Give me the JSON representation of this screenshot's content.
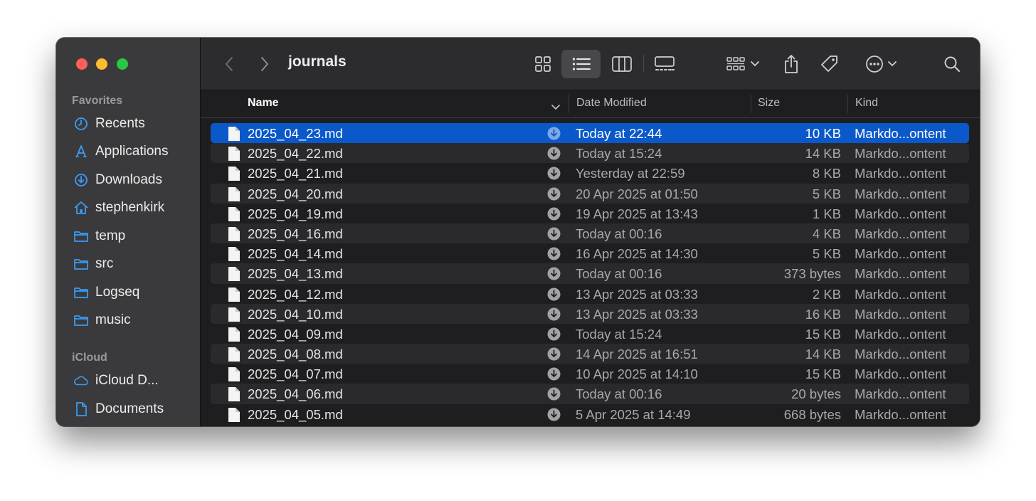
{
  "window": {
    "title": "journals"
  },
  "sidebar": {
    "favorites_label": "Favorites",
    "favorites": [
      {
        "label": "Recents",
        "icon": "clock-icon"
      },
      {
        "label": "Applications",
        "icon": "applications-icon"
      },
      {
        "label": "Downloads",
        "icon": "download-circle-icon"
      },
      {
        "label": "stephenkirk",
        "icon": "home-icon"
      },
      {
        "label": "temp",
        "icon": "folder-icon"
      },
      {
        "label": "src",
        "icon": "folder-icon"
      },
      {
        "label": "Logseq",
        "icon": "folder-icon"
      },
      {
        "label": "music",
        "icon": "folder-icon"
      }
    ],
    "icloud_label": "iCloud",
    "icloud": [
      {
        "label": "iCloud D...",
        "icon": "cloud-icon"
      },
      {
        "label": "Documents",
        "icon": "document-icon"
      }
    ]
  },
  "columns": {
    "name": "Name",
    "date": "Date Modified",
    "size": "Size",
    "kind": "Kind"
  },
  "files": [
    {
      "name": "2025_04_23.md",
      "date": "Today at 22:44",
      "size": "10 KB",
      "kind": "Markdo...ontent"
    },
    {
      "name": "2025_04_22.md",
      "date": "Today at 15:24",
      "size": "14 KB",
      "kind": "Markdo...ontent"
    },
    {
      "name": "2025_04_21.md",
      "date": "Yesterday at 22:59",
      "size": "8 KB",
      "kind": "Markdo...ontent"
    },
    {
      "name": "2025_04_20.md",
      "date": "20 Apr 2025 at 01:50",
      "size": "5 KB",
      "kind": "Markdo...ontent"
    },
    {
      "name": "2025_04_19.md",
      "date": "19 Apr 2025 at 13:43",
      "size": "1 KB",
      "kind": "Markdo...ontent"
    },
    {
      "name": "2025_04_16.md",
      "date": "Today at 00:16",
      "size": "4 KB",
      "kind": "Markdo...ontent"
    },
    {
      "name": "2025_04_14.md",
      "date": "16 Apr 2025 at 14:30",
      "size": "5 KB",
      "kind": "Markdo...ontent"
    },
    {
      "name": "2025_04_13.md",
      "date": "Today at 00:16",
      "size": "373 bytes",
      "kind": "Markdo...ontent"
    },
    {
      "name": "2025_04_12.md",
      "date": "13 Apr 2025 at 03:33",
      "size": "2 KB",
      "kind": "Markdo...ontent"
    },
    {
      "name": "2025_04_10.md",
      "date": "13 Apr 2025 at 03:33",
      "size": "16 KB",
      "kind": "Markdo...ontent"
    },
    {
      "name": "2025_04_09.md",
      "date": "Today at 15:24",
      "size": "15 KB",
      "kind": "Markdo...ontent"
    },
    {
      "name": "2025_04_08.md",
      "date": "14 Apr 2025 at 16:51",
      "size": "14 KB",
      "kind": "Markdo...ontent"
    },
    {
      "name": "2025_04_07.md",
      "date": "10 Apr 2025 at 14:10",
      "size": "15 KB",
      "kind": "Markdo...ontent"
    },
    {
      "name": "2025_04_06.md",
      "date": "Today at 00:16",
      "size": "20 bytes",
      "kind": "Markdo...ontent"
    },
    {
      "name": "2025_04_05.md",
      "date": "5 Apr 2025 at 14:49",
      "size": "668 bytes",
      "kind": "Markdo...ontent"
    }
  ],
  "selected_file": "2025_04_23.md",
  "colors": {
    "selection": "#0a58ca",
    "sidebar_icon": "#3b9cf5"
  }
}
